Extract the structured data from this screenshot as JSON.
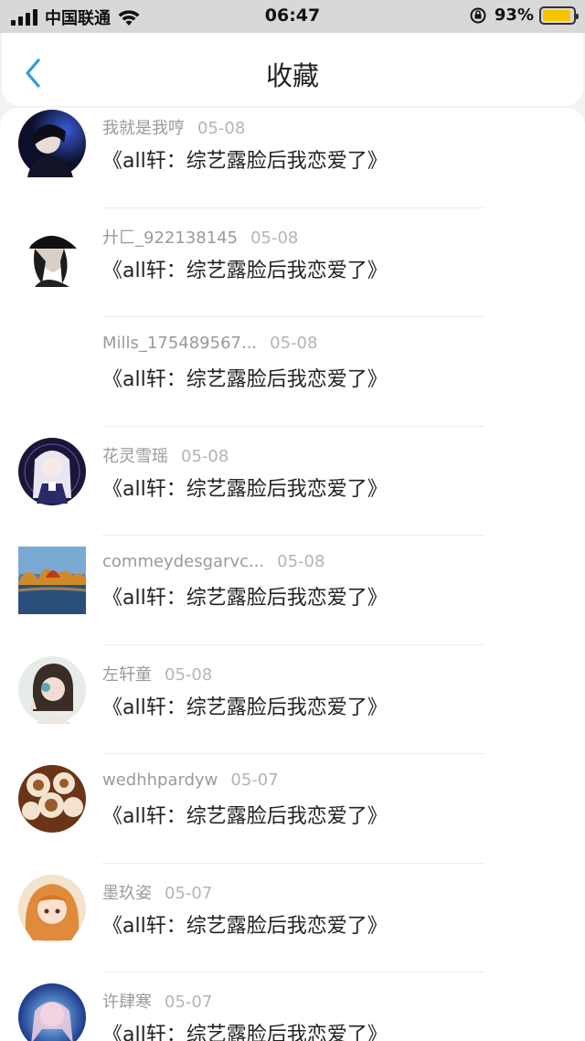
{
  "status": {
    "carrier": "中国联通",
    "time": "06:47",
    "battery": "93%",
    "battery_level": 0.93,
    "battery_color": "#f7c500"
  },
  "nav": {
    "title": "收藏",
    "back_icon": "chevron-left-icon",
    "accent": "#2d9cdb"
  },
  "items": [
    {
      "user": "我就是我哼",
      "date": "05-08",
      "title": "《all轩：综艺露脸后我恋爱了》",
      "avatar": "avatar-dark-blue"
    },
    {
      "user": "廾匚_922138145",
      "date": "05-08",
      "title": "《all轩：综艺露脸后我恋爱了》",
      "avatar": "avatar-black-cap"
    },
    {
      "user": "Mills_175489567...",
      "date": "05-08",
      "title": "《all轩：综艺露脸后我恋爱了》",
      "avatar": "avatar-none"
    },
    {
      "user": "花灵雪瑶",
      "date": "05-08",
      "title": "《all轩：综艺露脸后我恋爱了》",
      "avatar": "avatar-anime-girl"
    },
    {
      "user": "commeydesgarvc...",
      "date": "05-08",
      "title": "《all轩：综艺露脸后我恋爱了》",
      "avatar": "avatar-landscape"
    },
    {
      "user": "左轩童",
      "date": "05-08",
      "title": "《all轩：综艺露脸后我恋爱了》",
      "avatar": "avatar-girl-photo"
    },
    {
      "user": "wedhhpardyw",
      "date": "05-07",
      "title": "《all轩：综艺露脸后我恋爱了》",
      "avatar": "avatar-latte-art"
    },
    {
      "user": "墨玖姿",
      "date": "05-07",
      "title": "《all轩：综艺露脸后我恋爱了》",
      "avatar": "avatar-anime-orange"
    },
    {
      "user": "许肆寒",
      "date": "05-07",
      "title": "《all轩：综艺露脸后我恋爱了》",
      "avatar": "avatar-blue-glow"
    }
  ]
}
